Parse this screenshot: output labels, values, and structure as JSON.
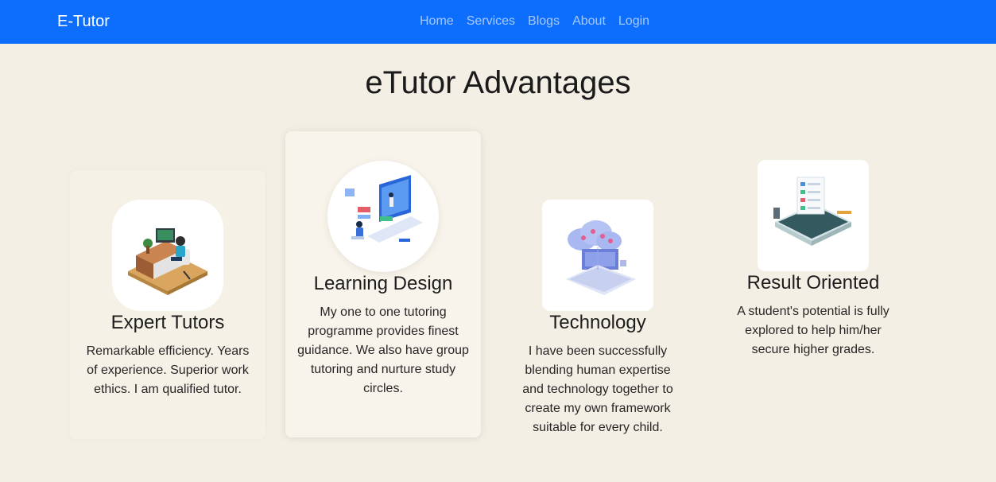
{
  "navbar": {
    "brand": "E-Tutor",
    "links": [
      "Home",
      "Services",
      "Blogs",
      "About",
      "Login"
    ]
  },
  "section": {
    "title": "eTutor Advantages"
  },
  "cards": [
    {
      "title": "Expert Tutors",
      "text": "Remarkable efficiency. Years of experience. Superior work ethics. I am qualified tutor.",
      "icon": "tutor-desk-illustration"
    },
    {
      "title": "Learning Design",
      "text": "My one to one tutoring programme provides finest guidance. We also have group tutoring and nurture study circles.",
      "icon": "online-learning-illustration"
    },
    {
      "title": "Technology",
      "text": "I have been successfully blending human expertise and technology together to create my own framework suitable for every child.",
      "icon": "cloud-laptop-illustration"
    },
    {
      "title": "Result Oriented",
      "text": "A student's potential is fully explored to help him/her secure higher grades.",
      "icon": "checklist-tablet-illustration"
    }
  ],
  "colors": {
    "navbar": "#0d6efd",
    "background": "#f3efe4",
    "nav_link": "rgba(255,255,255,0.62)"
  }
}
